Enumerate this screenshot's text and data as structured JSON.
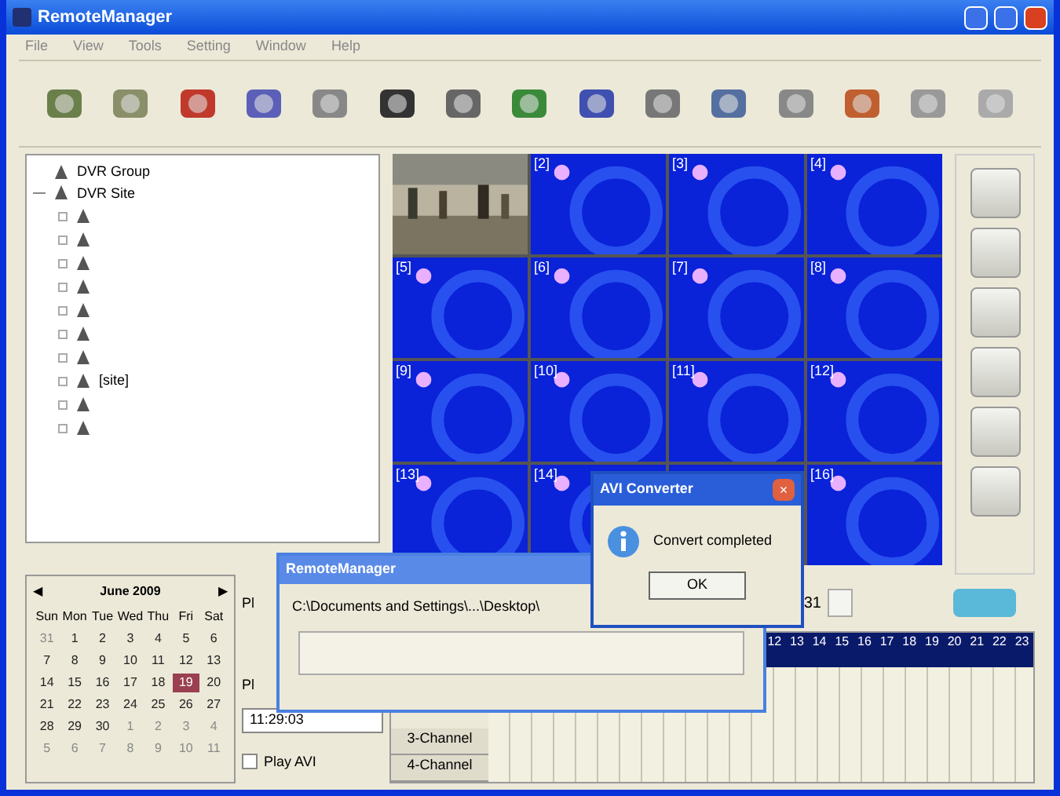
{
  "window": {
    "title": "RemoteManager"
  },
  "menu": [
    "File",
    "View",
    "Tools",
    "Setting",
    "Window",
    "Help"
  ],
  "tree": {
    "label": "DVR Group",
    "children": [
      {
        "label": "DVR Site",
        "expanded": true,
        "children": [
          {
            "kind": "camera"
          },
          {
            "kind": "camera"
          },
          {
            "kind": "camera"
          },
          {
            "kind": "camera"
          },
          {
            "kind": "camera"
          },
          {
            "kind": "camera"
          },
          {
            "kind": "camera"
          },
          {
            "kind": "camera",
            "label": "[site]"
          },
          {
            "kind": "camera"
          },
          {
            "kind": "camera"
          }
        ]
      }
    ]
  },
  "video_cells": [
    {
      "kind": "picture"
    },
    {
      "kind": "empty",
      "label": "[2]"
    },
    {
      "kind": "empty",
      "label": "[3]"
    },
    {
      "kind": "empty",
      "label": "[4]"
    },
    {
      "kind": "empty",
      "label": "[5]"
    },
    {
      "kind": "empty",
      "label": "[6]"
    },
    {
      "kind": "empty",
      "label": "[7]"
    },
    {
      "kind": "empty",
      "label": "[8]"
    },
    {
      "kind": "empty",
      "label": "[9]"
    },
    {
      "kind": "empty",
      "label": "[10]"
    },
    {
      "kind": "empty",
      "label": "[11]"
    },
    {
      "kind": "empty",
      "label": "[12]"
    },
    {
      "kind": "empty",
      "label": "[13]"
    },
    {
      "kind": "empty",
      "label": "[14]"
    },
    {
      "kind": "empty"
    },
    {
      "kind": "empty",
      "label": "[16]"
    }
  ],
  "calendar": {
    "month": "June 2009",
    "prev": "◀",
    "next": "▶",
    "weekdays": [
      "Sun",
      "Mon",
      "Tue",
      "Wed",
      "Thu",
      "Fri",
      "Sat"
    ],
    "weeks": [
      [
        {
          "d": "31",
          "other": true,
          "selected": false
        },
        {
          "d": "1",
          "other": false,
          "selected": false
        },
        {
          "d": "2",
          "other": false,
          "selected": false
        },
        {
          "d": "3",
          "other": false,
          "selected": false
        },
        {
          "d": "4",
          "other": false,
          "selected": false
        },
        {
          "d": "5",
          "other": false,
          "selected": false
        },
        {
          "d": "6",
          "other": false,
          "selected": false
        }
      ],
      [
        {
          "d": "7",
          "other": false,
          "selected": false
        },
        {
          "d": "8",
          "other": false,
          "selected": false
        },
        {
          "d": "9",
          "other": false,
          "selected": false
        },
        {
          "d": "10",
          "other": false,
          "selected": false
        },
        {
          "d": "11",
          "other": false,
          "selected": false
        },
        {
          "d": "12",
          "other": false,
          "selected": false
        },
        {
          "d": "13",
          "other": false,
          "selected": false
        }
      ],
      [
        {
          "d": "14",
          "other": false,
          "selected": false
        },
        {
          "d": "15",
          "other": false,
          "selected": false
        },
        {
          "d": "16",
          "other": false,
          "selected": false
        },
        {
          "d": "17",
          "other": false,
          "selected": false
        },
        {
          "d": "18",
          "other": false,
          "selected": false
        },
        {
          "d": "19",
          "other": false,
          "selected": true
        },
        {
          "d": "20",
          "other": false,
          "selected": false
        }
      ],
      [
        {
          "d": "21",
          "other": false,
          "selected": false
        },
        {
          "d": "22",
          "other": false,
          "selected": false
        },
        {
          "d": "23",
          "other": false,
          "selected": false
        },
        {
          "d": "24",
          "other": false,
          "selected": false
        },
        {
          "d": "25",
          "other": false,
          "selected": false
        },
        {
          "d": "26",
          "other": false,
          "selected": false
        },
        {
          "d": "27",
          "other": false,
          "selected": false
        }
      ],
      [
        {
          "d": "28",
          "other": false,
          "selected": false
        },
        {
          "d": "29",
          "other": false,
          "selected": false
        },
        {
          "d": "30",
          "other": false,
          "selected": false
        },
        {
          "d": "1",
          "other": true,
          "selected": false
        },
        {
          "d": "2",
          "other": true,
          "selected": false
        },
        {
          "d": "3",
          "other": true,
          "selected": false
        },
        {
          "d": "4",
          "other": true,
          "selected": false
        }
      ],
      [
        {
          "d": "5",
          "other": true,
          "selected": false
        },
        {
          "d": "6",
          "other": true,
          "selected": false
        },
        {
          "d": "7",
          "other": true,
          "selected": false
        },
        {
          "d": "8",
          "other": true,
          "selected": false
        },
        {
          "d": "9",
          "other": true,
          "selected": false
        },
        {
          "d": "10",
          "other": true,
          "selected": false
        },
        {
          "d": "11",
          "other": true,
          "selected": false
        }
      ]
    ]
  },
  "playback": {
    "label_1": "Pl",
    "label_2": "Pl",
    "time": "11:29:03",
    "play_avi": {
      "label": "Play AVI",
      "checked": false
    }
  },
  "spin": {
    "value": "31"
  },
  "timeline": {
    "hours": [
      "12",
      "13",
      "14",
      "15",
      "16",
      "17",
      "18",
      "19",
      "20",
      "21",
      "22",
      "23"
    ],
    "channels": [
      "3-Channel",
      "4-Channel"
    ]
  },
  "progress_dialog": {
    "title": "RemoteManager",
    "path": "C:\\Documents and Settings\\...\\Desktop\\"
  },
  "avi_dialog": {
    "title": "AVI Converter",
    "close": "×",
    "message": "Convert completed",
    "button": "OK"
  }
}
